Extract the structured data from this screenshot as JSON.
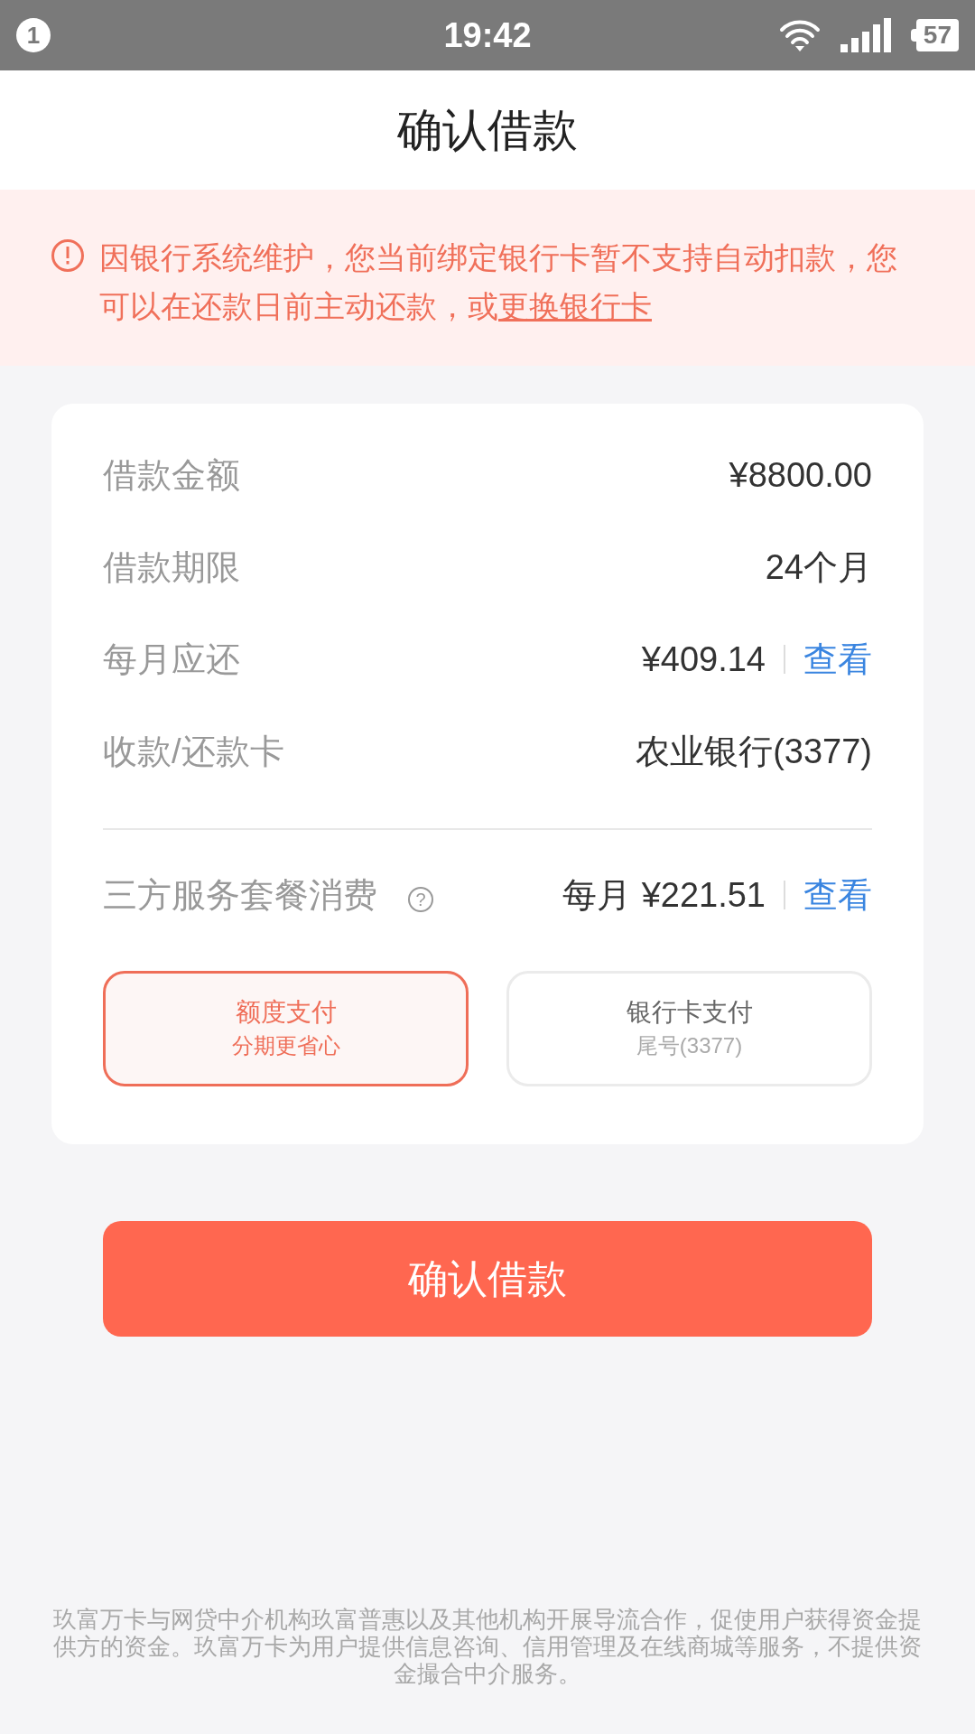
{
  "status_bar": {
    "notification_count": "1",
    "time": "19:42",
    "battery": "57"
  },
  "header": {
    "title": "确认借款"
  },
  "notice": {
    "text": "因银行系统维护，您当前绑定银行卡暂不支持自动扣款，您可以在还款日前主动还款，或",
    "link": "更换银行卡"
  },
  "details": [
    {
      "label": "借款金额",
      "value": "¥8800.00"
    },
    {
      "label": "借款期限",
      "value": "24个月"
    },
    {
      "label": "每月应还",
      "value": "¥409.14",
      "link": "查看"
    },
    {
      "label": "收款/还款卡",
      "value": "农业银行(3377)"
    }
  ],
  "service": {
    "label": "三方服务套餐消费",
    "help": "?",
    "prefix": "每月",
    "value": "¥221.51",
    "link": "查看"
  },
  "pay_options": [
    {
      "title": "额度支付",
      "subtitle": "分期更省心",
      "selected": true
    },
    {
      "title": "银行卡支付",
      "subtitle": "尾号(3377)",
      "selected": false
    }
  ],
  "confirm_button": "确认借款",
  "disclaimer": "玖富万卡与网贷中介机构玖富普惠以及其他机构开展导流合作，促使用户获得资金提供方的资金。玖富万卡为用户提供信息咨询、信用管理及在线商城等服务，不提供资金撮合中介服务。"
}
